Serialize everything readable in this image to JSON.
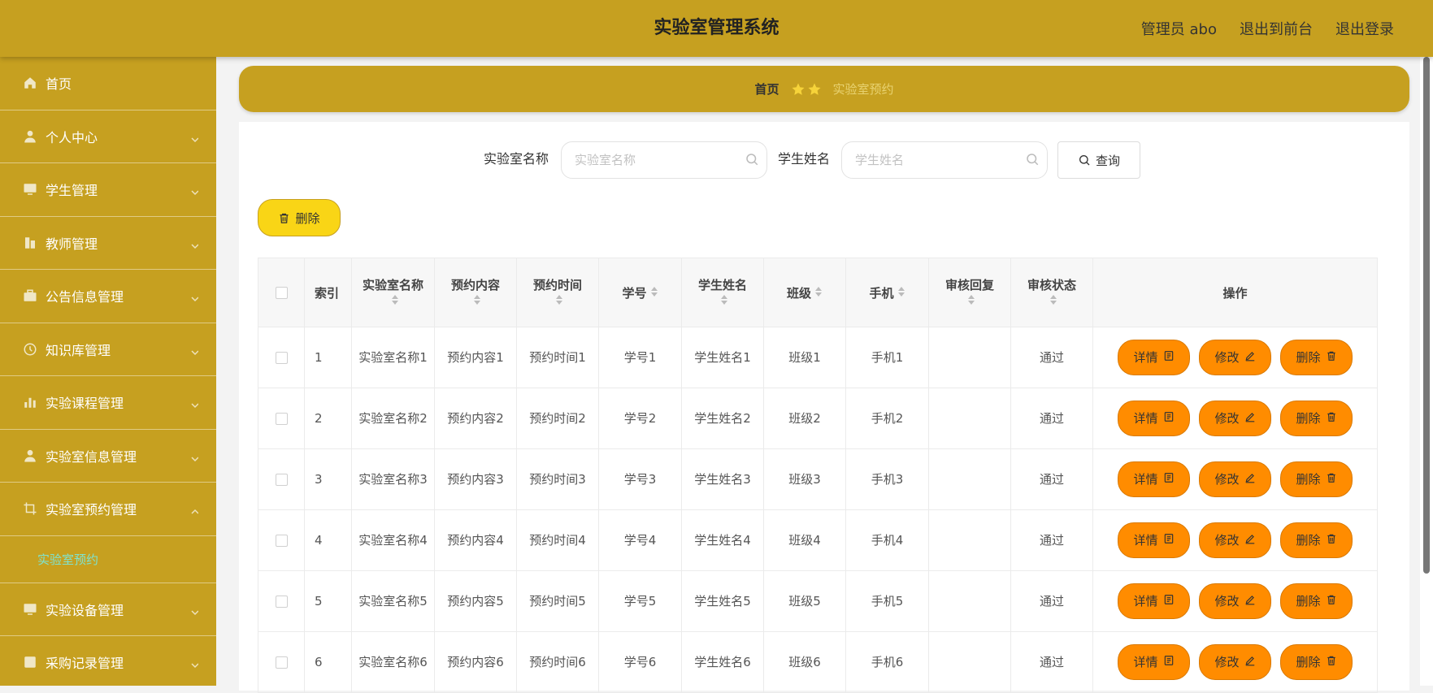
{
  "header": {
    "title": "实验室管理系统",
    "user_label": "管理员 abo",
    "front_label": "退出到前台",
    "logout_label": "退出登录"
  },
  "sidebar": {
    "items": [
      {
        "label": "首页",
        "icon": "home-icon",
        "chevron": "none"
      },
      {
        "label": "个人中心",
        "icon": "user-icon",
        "chevron": "down"
      },
      {
        "label": "学生管理",
        "icon": "monitor-icon",
        "chevron": "down"
      },
      {
        "label": "教师管理",
        "icon": "building-icon",
        "chevron": "down"
      },
      {
        "label": "公告信息管理",
        "icon": "briefcase-icon",
        "chevron": "down"
      },
      {
        "label": "知识库管理",
        "icon": "clock-icon",
        "chevron": "down"
      },
      {
        "label": "实验课程管理",
        "icon": "bar-chart-icon",
        "chevron": "down"
      },
      {
        "label": "实验室信息管理",
        "icon": "user-icon",
        "chevron": "down"
      },
      {
        "label": "实验室预约管理",
        "icon": "crop-icon",
        "chevron": "up"
      }
    ],
    "sub_item": "实验室预约",
    "items_after": [
      {
        "label": "实验设备管理",
        "icon": "monitor-icon",
        "chevron": "down"
      },
      {
        "label": "采购记录管理",
        "icon": "list-icon",
        "chevron": "down"
      }
    ]
  },
  "breadcrumb": {
    "home": "首页",
    "current": "实验室预约"
  },
  "search": {
    "lab_label": "实验室名称",
    "lab_placeholder": "实验室名称",
    "student_label": "学生姓名",
    "student_placeholder": "学生姓名",
    "query_label": "查询"
  },
  "actions": {
    "batch_delete_label": "删除"
  },
  "table": {
    "headers": {
      "index": "索引",
      "lab_name": "实验室名称",
      "content": "预约内容",
      "time": "预约时间",
      "student_no": "学号",
      "student_name": "学生姓名",
      "class": "班级",
      "phone": "手机",
      "reply": "审核回复",
      "status": "审核状态",
      "ops": "操作"
    },
    "row_buttons": {
      "detail": "详情",
      "edit": "修改",
      "delete": "删除"
    },
    "rows": [
      {
        "idx": "1",
        "lab": "实验室名称1",
        "content": "预约内容1",
        "time": "预约时间1",
        "no": "学号1",
        "name": "学生姓名1",
        "cls": "班级1",
        "phone": "手机1",
        "reply": "",
        "status": "通过"
      },
      {
        "idx": "2",
        "lab": "实验室名称2",
        "content": "预约内容2",
        "time": "预约时间2",
        "no": "学号2",
        "name": "学生姓名2",
        "cls": "班级2",
        "phone": "手机2",
        "reply": "",
        "status": "通过"
      },
      {
        "idx": "3",
        "lab": "实验室名称3",
        "content": "预约内容3",
        "time": "预约时间3",
        "no": "学号3",
        "name": "学生姓名3",
        "cls": "班级3",
        "phone": "手机3",
        "reply": "",
        "status": "通过"
      },
      {
        "idx": "4",
        "lab": "实验室名称4",
        "content": "预约内容4",
        "time": "预约时间4",
        "no": "学号4",
        "name": "学生姓名4",
        "cls": "班级4",
        "phone": "手机4",
        "reply": "",
        "status": "通过"
      },
      {
        "idx": "5",
        "lab": "实验室名称5",
        "content": "预约内容5",
        "time": "预约时间5",
        "no": "学号5",
        "name": "学生姓名5",
        "cls": "班级5",
        "phone": "手机5",
        "reply": "",
        "status": "通过"
      },
      {
        "idx": "6",
        "lab": "实验室名称6",
        "content": "预约内容6",
        "time": "预约时间6",
        "no": "学号6",
        "name": "学生姓名6",
        "cls": "班级6",
        "phone": "手机6",
        "reply": "",
        "status": "通过"
      }
    ]
  },
  "colors": {
    "brand": "#c6a020",
    "action_orange": "#ff8c00",
    "batch_delete_yellow": "#f9d516",
    "active_submenu": "#7fe3cf"
  }
}
